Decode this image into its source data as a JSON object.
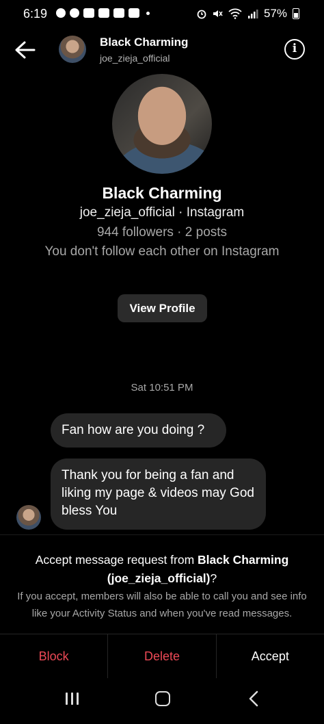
{
  "status_bar": {
    "time": "6:19",
    "battery": "57%"
  },
  "header": {
    "name": "Black Charming",
    "username": "joe_zieja_official"
  },
  "profile": {
    "name": "Black Charming",
    "subtitle": "joe_zieja_official · Instagram",
    "stats": "944 followers · 2 posts",
    "follow_status": "You don't follow each other on Instagram",
    "view_profile_label": "View Profile"
  },
  "conversation": {
    "timestamp": "Sat 10:51 PM",
    "messages": [
      {
        "text": "Fan how are you doing ?"
      },
      {
        "text": "Thank you for being a fan and liking my page & videos may God bless You"
      }
    ]
  },
  "request": {
    "title_prefix": "Accept message request from ",
    "title_name": "Black Charming",
    "title_user": "(joe_zieja_official)",
    "title_suffix": "?",
    "description": "If you accept, members will also be able to call you and see info like your Activity Status and when you've read messages."
  },
  "actions": {
    "block": "Block",
    "delete": "Delete",
    "accept": "Accept"
  },
  "colors": {
    "background": "#000000",
    "bubble": "#262626",
    "destructive": "#ed4956",
    "secondary_text": "#a8a8a8"
  }
}
